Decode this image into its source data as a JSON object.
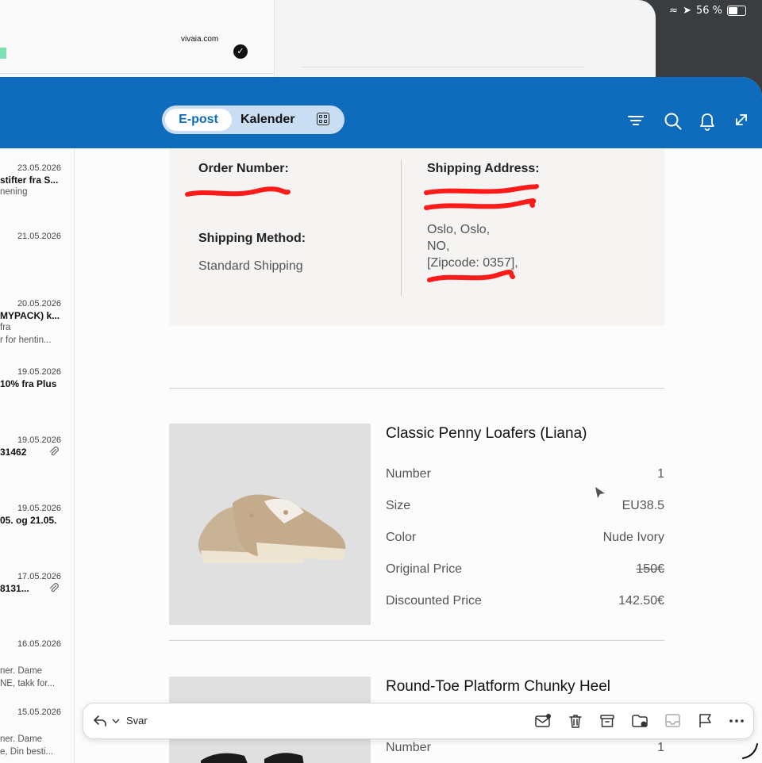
{
  "status_bar": {
    "battery": "56 %"
  },
  "background_window": {
    "site": "vivaia.com"
  },
  "topbar": {
    "tabs": [
      {
        "label": "E-post",
        "active": true
      },
      {
        "label": "Kalender",
        "active": false
      }
    ]
  },
  "mail_list": [
    {
      "date": "23.05.2026",
      "line1": "stifter fra S...",
      "line2": "nening",
      "line3": ""
    },
    {
      "date": "21.05.2026",
      "line1": "",
      "line2": "",
      "line3": ""
    },
    {
      "date": "20.05.2026",
      "line1": "MYPACK) k...",
      "line2": "fra",
      "line3": "r for hentin..."
    },
    {
      "date": "19.05.2026",
      "line1": "10% fra Plus",
      "line2": "",
      "line3": ""
    },
    {
      "date": "19.05.2026",
      "line1": "31462",
      "line2": "",
      "line3": "",
      "attachment": true
    },
    {
      "date": "19.05.2026",
      "line1": "05. og 21.05.",
      "line2": "",
      "line3": ""
    },
    {
      "date": "17.05.2026",
      "line1": "8131...",
      "line2": "",
      "line3": "",
      "attachment": true
    },
    {
      "date": "16.05.2026",
      "line1": "",
      "line2": "ner. Dame",
      "line3": "NE, takk for..."
    },
    {
      "date": "15.05.2026",
      "line1": "",
      "line2": "ner. Dame",
      "line3": "e, Din besti..."
    }
  ],
  "order": {
    "order_number_label": "Order Number:",
    "shipping_method_label": "Shipping Method:",
    "shipping_method": "Standard Shipping",
    "shipping_address_label": "Shipping Address:",
    "address_lines": [
      "",
      "",
      "Oslo, Oslo,",
      "NO,",
      "[Zipcode: 0357],",
      ""
    ]
  },
  "products": [
    {
      "title": "Classic Penny Loafers (Liana)",
      "rows": [
        {
          "key": "Number",
          "value": "1"
        },
        {
          "key": "Size",
          "value": "EU38.5"
        },
        {
          "key": "Color",
          "value": "Nude Ivory"
        },
        {
          "key": "Original Price",
          "value": "150€",
          "strike": true
        },
        {
          "key": "Discounted Price",
          "value": "142.50€"
        }
      ]
    },
    {
      "title": "Round-Toe Platform Chunky Heel",
      "rows": [
        {
          "key": "Number",
          "value": "1"
        }
      ]
    }
  ],
  "reply_toolbar": {
    "reply_label": "Svar"
  },
  "colors": {
    "brand": "#0f6cbd",
    "redaction": "#ff1a1a"
  }
}
